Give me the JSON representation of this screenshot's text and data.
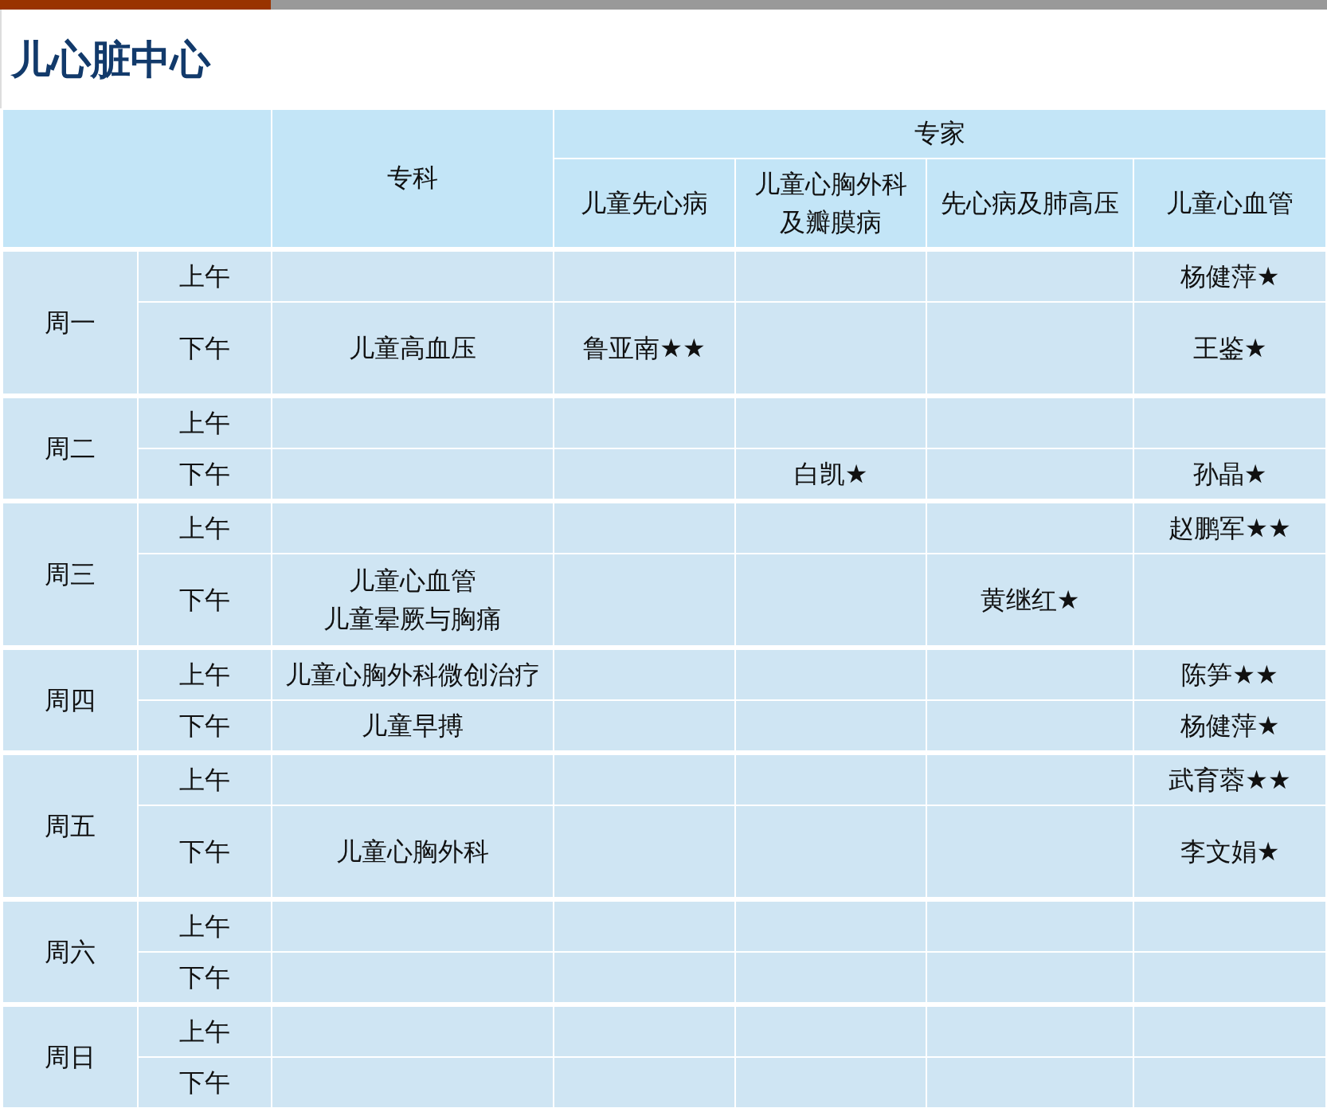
{
  "title": "儿心脏中心",
  "header": {
    "specialty": "专科",
    "experts_group": "专家",
    "expert_columns": [
      [
        "儿童先心病"
      ],
      [
        "儿童心胸外科",
        "及瓣膜病"
      ],
      [
        "先心病及肺高压"
      ],
      [
        "儿童心血管"
      ]
    ]
  },
  "days": [
    {
      "label": "周一",
      "slots": [
        {
          "label": "上午",
          "tall": false,
          "experts": [
            {
              "kind": "empty"
            },
            {
              "kind": "empty"
            },
            {
              "kind": "empty"
            },
            {
              "kind": "name",
              "text": "杨健萍★"
            }
          ]
        },
        {
          "label": "下午",
          "tall": true,
          "specialty": [
            "儿童高血压"
          ],
          "experts": [
            {
              "kind": "name",
              "text": "鲁亚南★★"
            },
            {
              "kind": "empty"
            },
            {
              "kind": "empty"
            },
            {
              "kind": "name",
              "text": "王鉴★"
            }
          ]
        }
      ]
    },
    {
      "label": "周二",
      "slots": [
        {
          "label": "上午",
          "tall": false,
          "experts": [
            {
              "kind": "empty"
            },
            {
              "kind": "empty"
            },
            {
              "kind": "empty"
            },
            {
              "kind": "empty"
            }
          ]
        },
        {
          "label": "下午",
          "tall": false,
          "experts": [
            {
              "kind": "empty"
            },
            {
              "kind": "name",
              "text": "白凯★"
            },
            {
              "kind": "empty"
            },
            {
              "kind": "name",
              "text": "孙晶★"
            }
          ]
        }
      ]
    },
    {
      "label": "周三",
      "slots": [
        {
          "label": "上午",
          "tall": false,
          "experts": [
            {
              "kind": "empty"
            },
            {
              "kind": "empty"
            },
            {
              "kind": "empty"
            },
            {
              "kind": "name",
              "text": "赵鹏军★★"
            }
          ]
        },
        {
          "label": "下午",
          "tall": true,
          "specialty": [
            "儿童心血管",
            "儿童晕厥与胸痛"
          ],
          "experts": [
            {
              "kind": "empty"
            },
            {
              "kind": "empty"
            },
            {
              "kind": "name",
              "text": "黄继红★"
            },
            {
              "kind": "empty"
            }
          ]
        }
      ]
    },
    {
      "label": "周四",
      "slots": [
        {
          "label": "上午",
          "tall": false,
          "specialty": [
            "儿童心胸外科微创治疗"
          ],
          "experts": [
            {
              "kind": "empty"
            },
            {
              "kind": "empty"
            },
            {
              "kind": "empty"
            },
            {
              "kind": "name",
              "text": "陈笋★★"
            }
          ]
        },
        {
          "label": "下午",
          "tall": false,
          "specialty": [
            "儿童早搏"
          ],
          "experts": [
            {
              "kind": "empty"
            },
            {
              "kind": "empty"
            },
            {
              "kind": "empty"
            },
            {
              "kind": "name",
              "text": "杨健萍★"
            }
          ]
        }
      ]
    },
    {
      "label": "周五",
      "slots": [
        {
          "label": "上午",
          "tall": false,
          "experts": [
            {
              "kind": "empty"
            },
            {
              "kind": "empty"
            },
            {
              "kind": "empty"
            },
            {
              "kind": "name",
              "text": "武育蓉★★"
            }
          ]
        },
        {
          "label": "下午",
          "tall": true,
          "specialty": [
            "儿童心胸外科"
          ],
          "experts": [
            {
              "kind": "empty"
            },
            {
              "kind": "empty"
            },
            {
              "kind": "empty"
            },
            {
              "kind": "name",
              "text": "李文娟★"
            }
          ]
        }
      ]
    },
    {
      "label": "周六",
      "slots": [
        {
          "label": "上午",
          "tall": false,
          "experts": [
            {
              "kind": "empty"
            },
            {
              "kind": "empty"
            },
            {
              "kind": "empty"
            },
            {
              "kind": "empty"
            }
          ]
        },
        {
          "label": "下午",
          "tall": false,
          "experts": [
            {
              "kind": "empty"
            },
            {
              "kind": "empty"
            },
            {
              "kind": "empty"
            },
            {
              "kind": "empty"
            }
          ]
        }
      ]
    },
    {
      "label": "周日",
      "slots": [
        {
          "label": "上午",
          "tall": false,
          "experts": [
            {
              "kind": "empty"
            },
            {
              "kind": "empty"
            },
            {
              "kind": "empty"
            },
            {
              "kind": "empty"
            }
          ]
        },
        {
          "label": "下午",
          "tall": false,
          "experts": [
            {
              "kind": "empty"
            },
            {
              "kind": "empty"
            },
            {
              "kind": "empty"
            },
            {
              "kind": "empty"
            }
          ]
        }
      ]
    }
  ]
}
